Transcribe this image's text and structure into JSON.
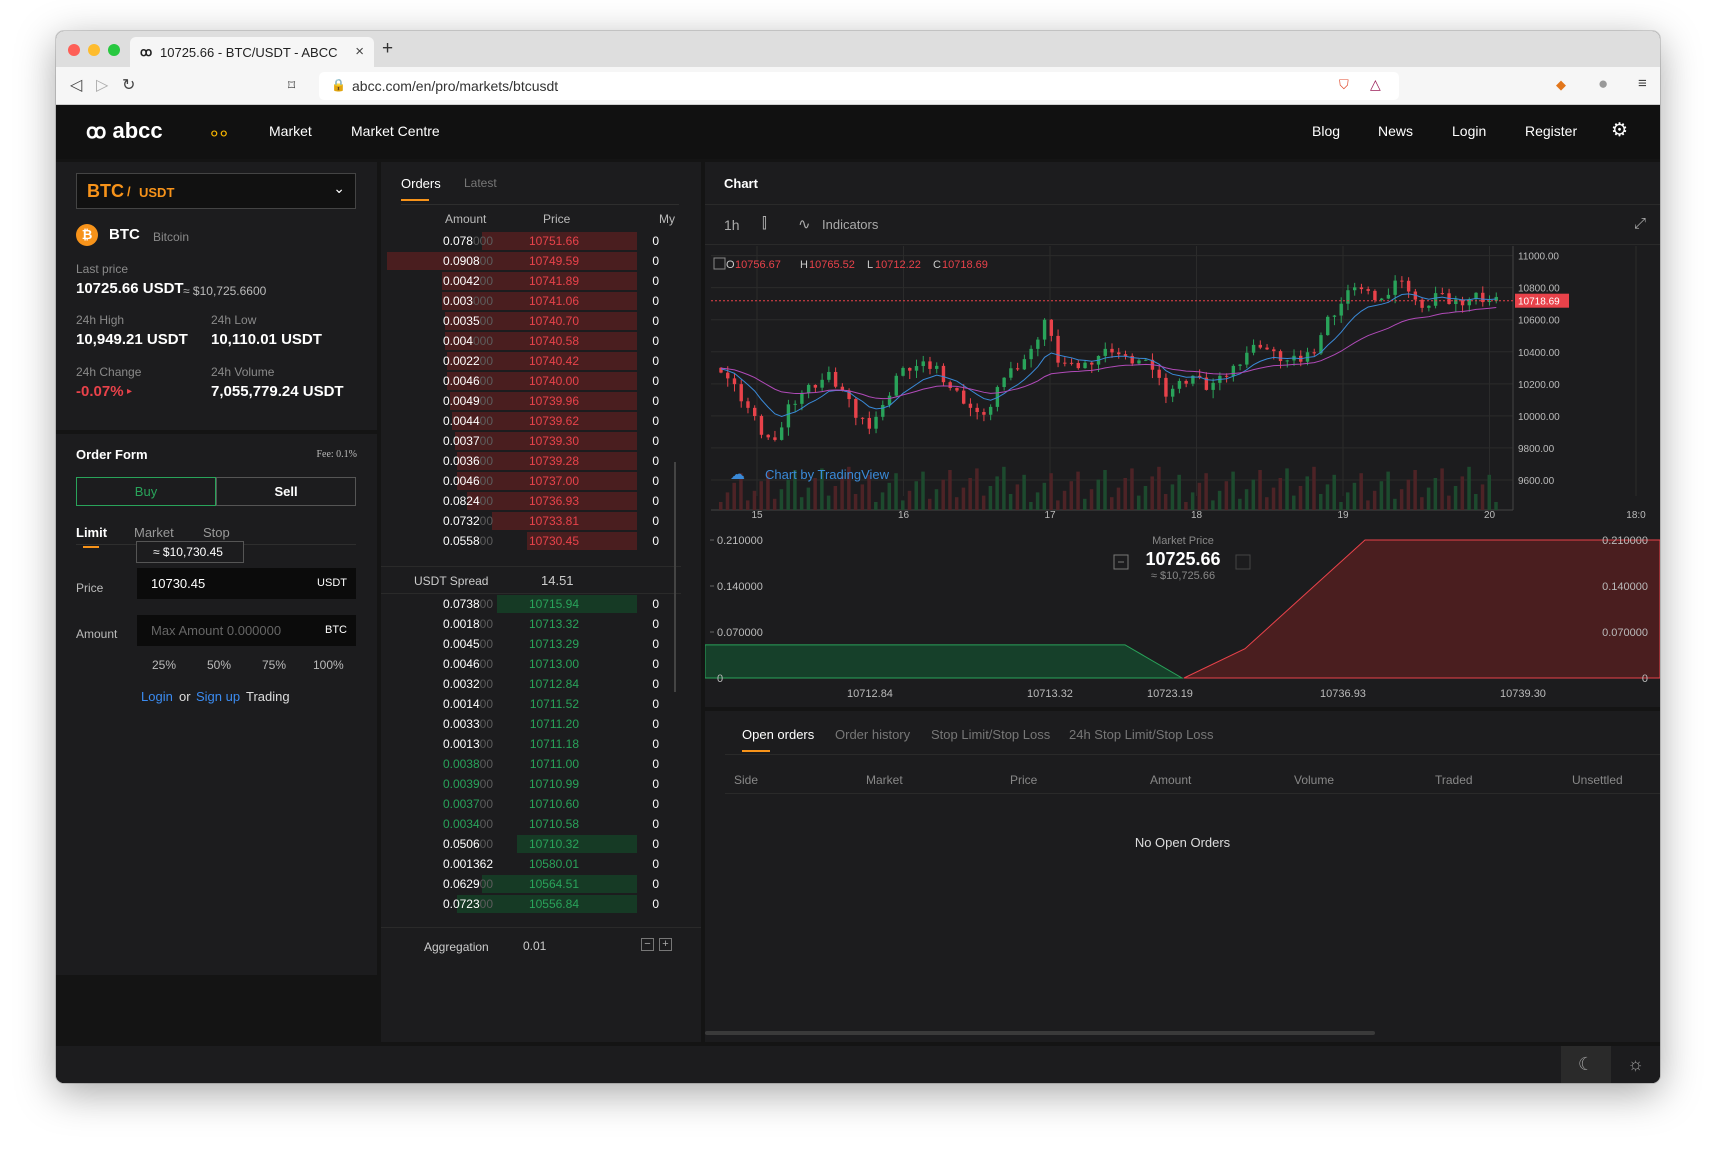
{
  "browser": {
    "tab_title": "10725.66 - BTC/USDT - ABCC",
    "url": "abcc.com/en/pro/markets/btcusdt"
  },
  "nav": {
    "logo": "abcc",
    "items": [
      "Market",
      "Market Centre"
    ],
    "right": [
      "Blog",
      "News",
      "Login",
      "Register"
    ]
  },
  "pair": {
    "base": "BTC",
    "quote": "USDT",
    "coin": "BTC",
    "coin_name": "Bitcoin"
  },
  "stats": {
    "last_price_label": "Last price",
    "last_price": "10725.66 USDT",
    "last_price_fiat": "≈ $10,725.6600",
    "high_label": "24h High",
    "high": "10,949.21 USDT",
    "low_label": "24h Low",
    "low": "10,110.01 USDT",
    "change_label": "24h Change",
    "change": "-0.07%",
    "volume_label": "24h Volume",
    "volume": "7,055,779.24 USDT"
  },
  "order_form": {
    "title": "Order Form",
    "fee": "Fee: 0.1%",
    "buy": "Buy",
    "sell": "Sell",
    "types": [
      "Limit",
      "Market",
      "Stop"
    ],
    "tooltip": "≈ $10,730.45",
    "price_label": "Price",
    "price_value": "10730.45",
    "price_unit": "USDT",
    "amount_label": "Amount",
    "amount_placeholder": "Max Amount 0.000000",
    "amount_unit": "BTC",
    "percents": [
      "25%",
      "50%",
      "75%",
      "100%"
    ],
    "login": "Login",
    "or": "or",
    "signup": "Sign up",
    "trading": "Trading"
  },
  "orderbook": {
    "tabs": [
      "Orders",
      "Latest"
    ],
    "headers": [
      "Amount",
      "Price",
      "My"
    ],
    "spread_label": "USDT Spread",
    "spread_value": "14.51",
    "aggregation_label": "Aggregation",
    "aggregation_value": "0.01",
    "asks": [
      {
        "a": "0.078",
        "z": "000",
        "p": "10751.66",
        "m": "0",
        "d": 0.62
      },
      {
        "a": "0.0908",
        "z": "00",
        "p": "10749.59",
        "m": "0",
        "d": 1.0
      },
      {
        "a": "0.0042",
        "z": "00",
        "p": "10741.89",
        "m": "0",
        "d": 0.78
      },
      {
        "a": "0.003",
        "z": "000",
        "p": "10741.06",
        "m": "0",
        "d": 0.78
      },
      {
        "a": "0.0035",
        "z": "00",
        "p": "10740.70",
        "m": "0",
        "d": 0.77
      },
      {
        "a": "0.004",
        "z": "000",
        "p": "10740.58",
        "m": "0",
        "d": 0.77
      },
      {
        "a": "0.0022",
        "z": "00",
        "p": "10740.42",
        "m": "0",
        "d": 0.76
      },
      {
        "a": "0.0046",
        "z": "00",
        "p": "10740.00",
        "m": "0",
        "d": 0.76
      },
      {
        "a": "0.0049",
        "z": "00",
        "p": "10739.96",
        "m": "0",
        "d": 0.75
      },
      {
        "a": "0.0044",
        "z": "00",
        "p": "10739.62",
        "m": "0",
        "d": 0.74
      },
      {
        "a": "0.0037",
        "z": "00",
        "p": "10739.30",
        "m": "0",
        "d": 0.73
      },
      {
        "a": "0.0036",
        "z": "00",
        "p": "10739.28",
        "m": "0",
        "d": 0.72
      },
      {
        "a": "0.0046",
        "z": "00",
        "p": "10737.00",
        "m": "0",
        "d": 0.72
      },
      {
        "a": "0.0824",
        "z": "00",
        "p": "10736.93",
        "m": "0",
        "d": 0.68
      },
      {
        "a": "0.0732",
        "z": "00",
        "p": "10733.81",
        "m": "0",
        "d": 0.58
      },
      {
        "a": "0.0558",
        "z": "00",
        "p": "10730.45",
        "m": "0",
        "d": 0.44
      }
    ],
    "bids": [
      {
        "a": "0.0738",
        "z": "00",
        "p": "10715.94",
        "m": "0",
        "d": 0.56,
        "g": false
      },
      {
        "a": "0.0018",
        "z": "00",
        "p": "10713.32",
        "m": "0",
        "d": 0.0,
        "g": false
      },
      {
        "a": "0.0045",
        "z": "00",
        "p": "10713.29",
        "m": "0",
        "d": 0.0,
        "g": false
      },
      {
        "a": "0.0046",
        "z": "00",
        "p": "10713.00",
        "m": "0",
        "d": 0.0,
        "g": false
      },
      {
        "a": "0.0032",
        "z": "00",
        "p": "10712.84",
        "m": "0",
        "d": 0.0,
        "g": false
      },
      {
        "a": "0.0014",
        "z": "00",
        "p": "10711.52",
        "m": "0",
        "d": 0.0,
        "g": false
      },
      {
        "a": "0.0033",
        "z": "00",
        "p": "10711.20",
        "m": "0",
        "d": 0.0,
        "g": false
      },
      {
        "a": "0.0013",
        "z": "00",
        "p": "10711.18",
        "m": "0",
        "d": 0.0,
        "g": false
      },
      {
        "a": "0.0038",
        "z": "00",
        "p": "10711.00",
        "m": "0",
        "d": 0.0,
        "g": true
      },
      {
        "a": "0.0039",
        "z": "00",
        "p": "10710.99",
        "m": "0",
        "d": 0.0,
        "g": true
      },
      {
        "a": "0.0037",
        "z": "00",
        "p": "10710.60",
        "m": "0",
        "d": 0.0,
        "g": true
      },
      {
        "a": "0.0034",
        "z": "00",
        "p": "10710.58",
        "m": "0",
        "d": 0.0,
        "g": true
      },
      {
        "a": "0.0506",
        "z": "00",
        "p": "10710.32",
        "m": "0",
        "d": 0.48,
        "g": false
      },
      {
        "a": "0.001362",
        "z": "",
        "p": "10580.01",
        "m": "0",
        "d": 0.0,
        "g": false
      },
      {
        "a": "0.0629",
        "z": "00",
        "p": "10564.51",
        "m": "0",
        "d": 0.62,
        "g": false
      },
      {
        "a": "0.0723",
        "z": "00",
        "p": "10556.84",
        "m": "0",
        "d": 0.72,
        "g": false
      }
    ]
  },
  "chart": {
    "title": "Chart",
    "interval": "1h",
    "indicators": "Indicators",
    "ohlc": {
      "o": "10756.67",
      "h": "10765.52",
      "l": "10712.22",
      "c": "10718.69"
    },
    "watermark": "Chart by TradingView",
    "current": "10718.69"
  },
  "chart_data": [
    {
      "type": "line",
      "title": "",
      "y_ticks": [
        "11000.00",
        "10800.00",
        "10600.00",
        "10400.00",
        "10200.00",
        "10000.00",
        "9800.00",
        "9600.00"
      ],
      "x_ticks": [
        "15",
        "16",
        "17",
        "18",
        "19",
        "20",
        "18:0"
      ],
      "ylim": [
        9500,
        11060
      ],
      "last_price": 10718.69,
      "close": [
        10300,
        10180,
        10050,
        9900,
        9820,
        10060,
        10150,
        10200,
        10250,
        10150,
        10000,
        9950,
        10050,
        10250,
        10300,
        10310,
        10300,
        10180,
        10100,
        10000,
        10050,
        10250,
        10320,
        10400,
        10600,
        10350,
        10300,
        10320,
        10380,
        10420,
        10350,
        10340,
        10300,
        10150,
        10200,
        10250,
        10180,
        10220,
        10300,
        10400,
        10450,
        10380,
        10340,
        10350,
        10420,
        10600,
        10700,
        10820,
        10750,
        10720,
        10850,
        10800,
        10650,
        10760,
        10710,
        10720,
        10750,
        10718
      ]
    },
    {
      "type": "area",
      "title": "",
      "x_ticks": [
        "10712.84",
        "10713.32",
        "10723.19",
        "10736.93",
        "10739.30"
      ],
      "y_ticks": [
        "0.210000",
        "0.140000",
        "0.070000",
        "0"
      ],
      "ylim": [
        0,
        0.21
      ],
      "market_price_label": "Market Price",
      "market_price": "10725.66",
      "market_price_fiat": "≈ $10,725.66"
    }
  ],
  "orders": {
    "tabs": [
      "Open orders",
      "Order history",
      "Stop Limit/Stop Loss",
      "24h Stop Limit/Stop Loss"
    ],
    "headers": [
      "Side",
      "Market",
      "Price",
      "Amount",
      "Volume",
      "Traded",
      "Unsettled"
    ],
    "empty": "No Open Orders"
  },
  "colors": {
    "accent": "#f7931a",
    "red": "#e8424a",
    "green": "#29a35a"
  }
}
